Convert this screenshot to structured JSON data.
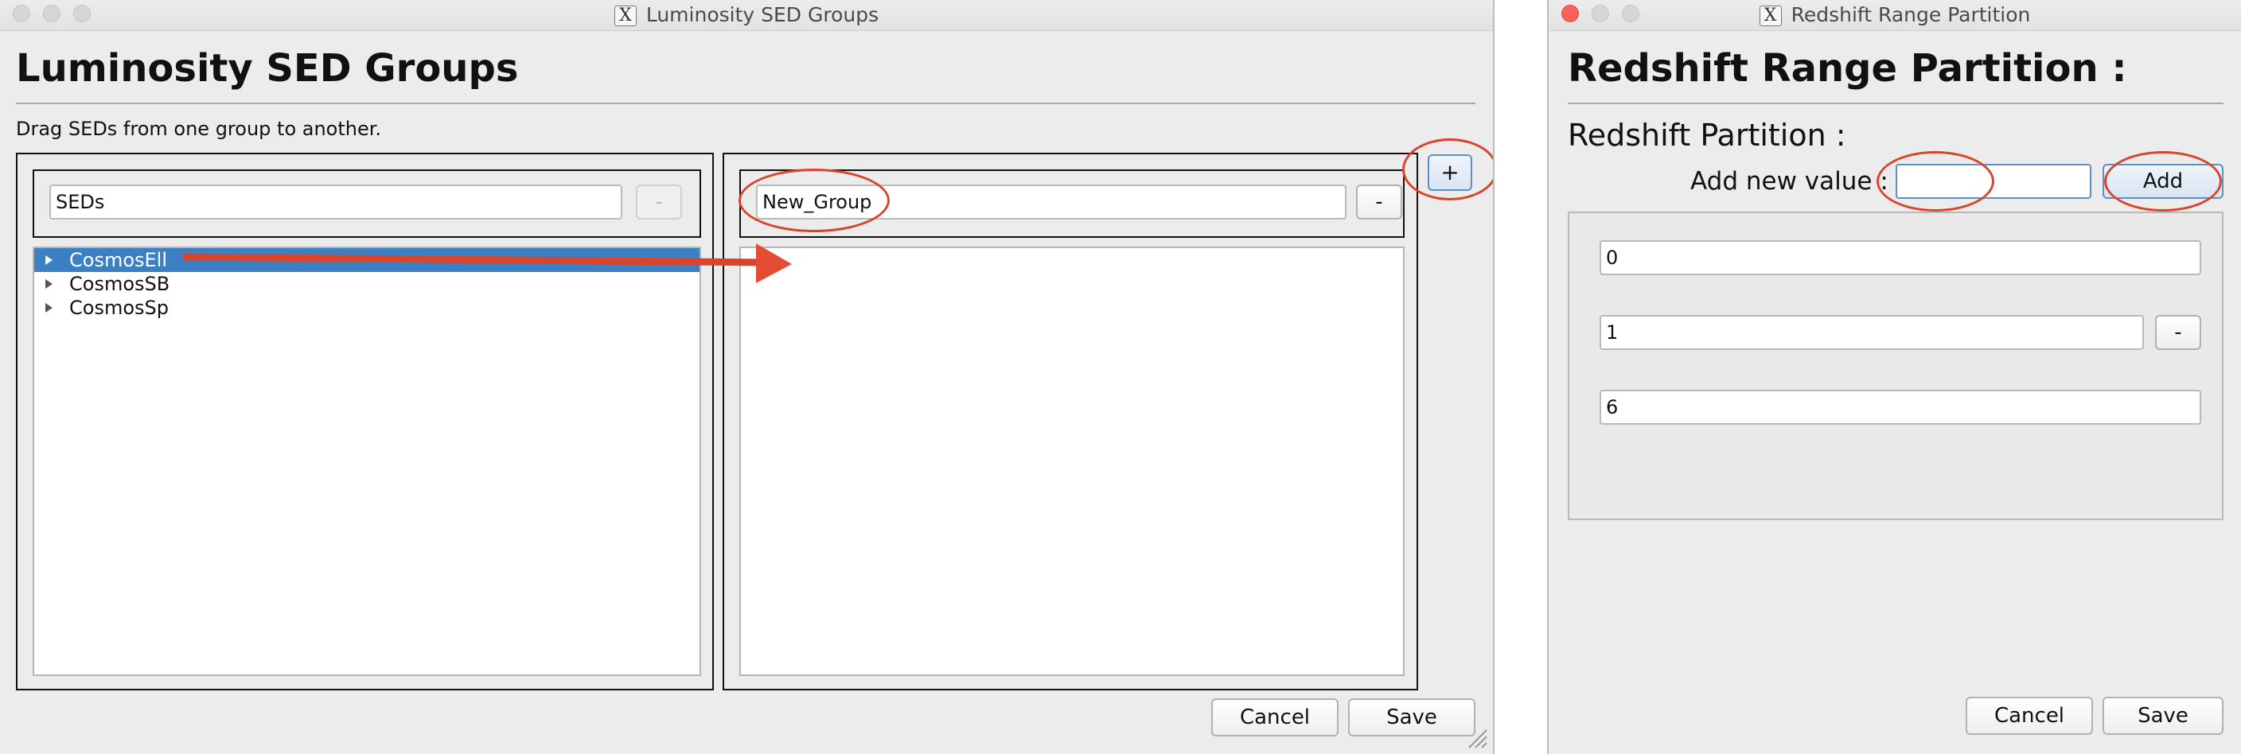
{
  "colors": {
    "accent": "#3b80c2",
    "annotation": "#d8452c",
    "close_button": "#fc605c"
  },
  "left_window": {
    "title": "Luminosity SED Groups",
    "title_icon": "x11-icon",
    "heading": "Luminosity SED Groups",
    "instruction": "Drag SEDs from one group to another.",
    "source_group": {
      "name_value": "SEDs",
      "remove_label": "-",
      "items": [
        {
          "label": "CosmosEll",
          "selected": true
        },
        {
          "label": "CosmosSB",
          "selected": false
        },
        {
          "label": "CosmosSp",
          "selected": false
        }
      ]
    },
    "target_group": {
      "name_value": "New_Group",
      "remove_label": "-",
      "items": []
    },
    "add_group_label": "+",
    "cancel_label": "Cancel",
    "save_label": "Save"
  },
  "right_window": {
    "title": "Redshift Range Partition",
    "title_icon": "x11-icon",
    "heading": "Redshift Range Partition :",
    "subheading": "Redshift Partition :",
    "add_value_label": "Add new value :",
    "add_value_input": "",
    "add_button_label": "Add",
    "values": [
      {
        "value": "0",
        "removable": false
      },
      {
        "value": "1",
        "removable": true
      },
      {
        "value": "6",
        "removable": false
      }
    ],
    "remove_label": "-",
    "cancel_label": "Cancel",
    "save_label": "Save"
  }
}
